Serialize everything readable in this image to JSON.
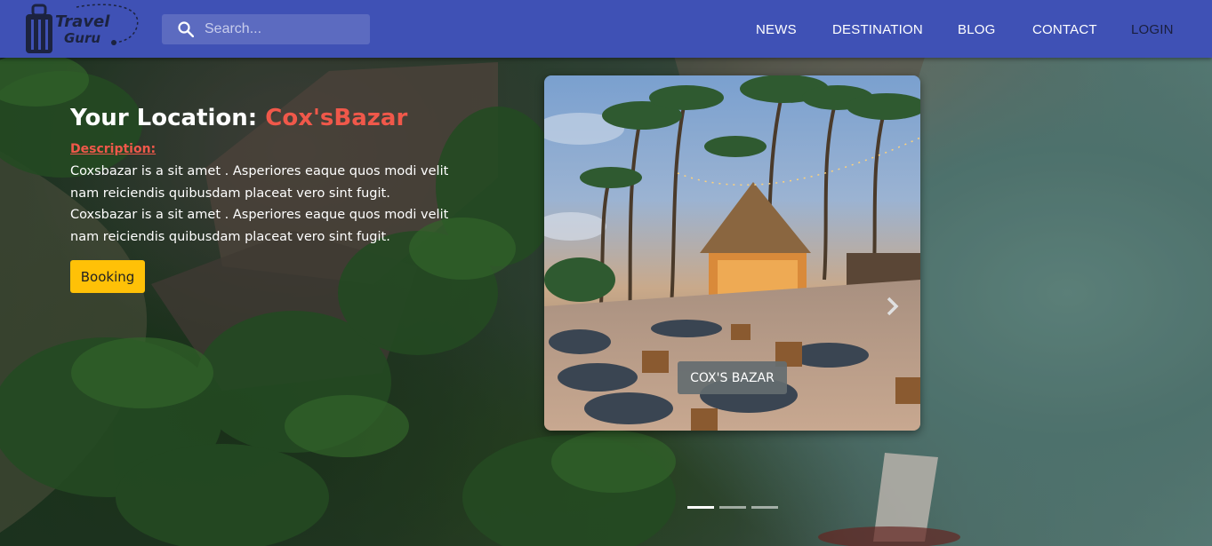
{
  "navbar": {
    "logo": {
      "line1": "Travel",
      "line2": "Guru"
    },
    "search": {
      "placeholder": "Search..."
    },
    "links": [
      {
        "label": "NEWS"
      },
      {
        "label": "DESTINATION"
      },
      {
        "label": "BLOG"
      },
      {
        "label": "CONTACT"
      },
      {
        "label": "LOGIN"
      }
    ]
  },
  "hero": {
    "location_prefix": "Your Location: ",
    "location_name": "Cox'sBazar",
    "description_label": "Description:",
    "description": "Coxsbazar is a sit amet . Asperiores eaque quos modi velit nam reiciendis quibusdam placeat vero sint fugit. Coxsbazar is a sit amet . Asperiores eaque quos modi velit nam reiciendis quibusdam placeat vero sint fugit.",
    "booking_label": "Booking"
  },
  "carousel": {
    "caption": "COX'S BAZAR",
    "slide_count": 3,
    "active_index": 0
  },
  "colors": {
    "navbar": "#3f51b5",
    "search_bg": "#5c6bc0",
    "accent_red": "#f0584a",
    "booking": "#ffc107"
  },
  "icons": {
    "logo": "suitcase-icon",
    "search": "search-icon",
    "prev": "chevron-left-icon",
    "next": "chevron-right-icon"
  }
}
